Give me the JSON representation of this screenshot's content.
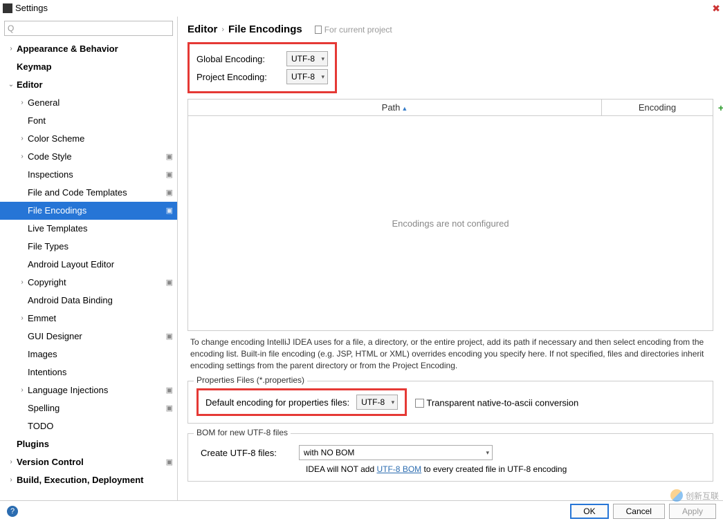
{
  "window": {
    "title": "Settings"
  },
  "search": {
    "placeholder": "Q"
  },
  "tree": {
    "appearance": "Appearance & Behavior",
    "keymap": "Keymap",
    "editor": "Editor",
    "general": "General",
    "font": "Font",
    "colorscheme": "Color Scheme",
    "codestyle": "Code Style",
    "inspections": "Inspections",
    "filecodetemplates": "File and Code Templates",
    "fileencodings": "File Encodings",
    "livetemplates": "Live Templates",
    "filetypes": "File Types",
    "androidlayout": "Android Layout Editor",
    "copyright": "Copyright",
    "androiddata": "Android Data Binding",
    "emmet": "Emmet",
    "guidesigner": "GUI Designer",
    "images": "Images",
    "intentions": "Intentions",
    "langinjections": "Language Injections",
    "spelling": "Spelling",
    "todo": "TODO",
    "plugins": "Plugins",
    "versioncontrol": "Version Control",
    "build": "Build, Execution, Deployment"
  },
  "breadcrumb": {
    "editor": "Editor",
    "fe": "File Encodings",
    "scope": "For current project"
  },
  "encoding": {
    "global_label": "Global Encoding:",
    "global_value": "UTF-8",
    "project_label": "Project Encoding:",
    "project_value": "UTF-8"
  },
  "table": {
    "path": "Path",
    "encoding": "Encoding",
    "empty": "Encodings are not configured"
  },
  "info": "To change encoding IntelliJ IDEA uses for a file, a directory, or the entire project, add its path if necessary and then select encoding from the encoding list. Built-in file encoding (e.g. JSP, HTML or XML) overrides encoding you specify here. If not specified, files and directories inherit encoding settings from the parent directory or from the Project Encoding.",
  "props": {
    "legend": "Properties Files (*.properties)",
    "label": "Default encoding for properties files:",
    "value": "UTF-8",
    "checkbox_label": "Transparent native-to-ascii conversion"
  },
  "bom": {
    "legend": "BOM for new UTF-8 files",
    "label": "Create UTF-8 files:",
    "value": "with NO BOM",
    "note_prefix": "IDEA will NOT add ",
    "note_link": "UTF-8 BOM",
    "note_suffix": " to every created file in UTF-8 encoding"
  },
  "footer": {
    "ok": "OK",
    "cancel": "Cancel",
    "apply": "Apply"
  },
  "watermark": "创新互联"
}
